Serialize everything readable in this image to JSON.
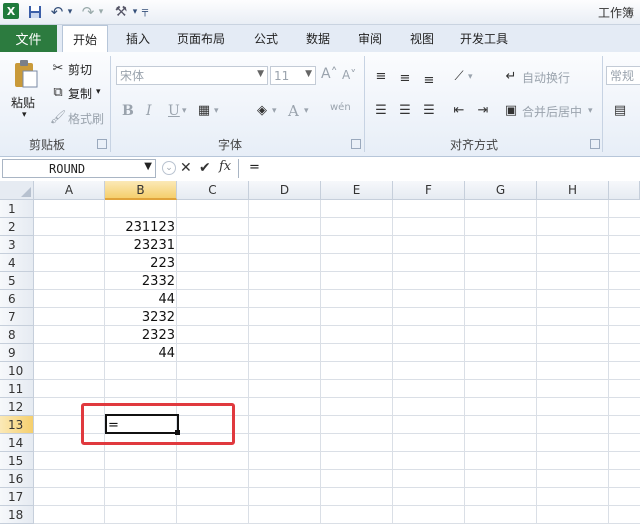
{
  "window": {
    "title": "工作簿"
  },
  "qat": {
    "undo_arrow": "▾",
    "redo_arrow": "▾",
    "custom": "╤"
  },
  "tabs": {
    "file": "文件",
    "items": [
      "开始",
      "插入",
      "页面布局",
      "公式",
      "数据",
      "审阅",
      "视图",
      "开发工具"
    ]
  },
  "clipboard": {
    "paste": "粘贴",
    "cut": "剪切",
    "copy": "复制",
    "format_painter": "格式刷",
    "group": "剪贴板"
  },
  "font": {
    "name": "宋体",
    "size": "11",
    "bold": "B",
    "italic": "I",
    "underline": "U",
    "grow": "A˄",
    "shrink": "A˅",
    "group": "字体",
    "phonetic": "wén"
  },
  "alignment": {
    "wrap": "自动换行",
    "merge": "合并后居中",
    "group": "对齐方式"
  },
  "number": {
    "format": "常规"
  },
  "formula_bar": {
    "name_box": "ROUND",
    "fx": "fx",
    "cancel": "✕",
    "enter": "✔",
    "content": "="
  },
  "columns": [
    "A",
    "B",
    "C",
    "D",
    "E",
    "F",
    "G",
    "H"
  ],
  "rows": [
    "1",
    "2",
    "3",
    "4",
    "5",
    "6",
    "7",
    "8",
    "9",
    "10",
    "11",
    "12",
    "13",
    "14",
    "15",
    "16",
    "17",
    "18"
  ],
  "cells": {
    "B2": "231123",
    "B3": "23231",
    "B4": "223",
    "B5": "2332",
    "B6": "44",
    "B7": "3232",
    "B8": "2323",
    "B9": "44",
    "B13": "="
  },
  "active_cell": "B13",
  "colors": {
    "file_tab": "#2c7b3f",
    "highlight_box": "#e0393e",
    "selected_header": "#f5cf6d"
  }
}
